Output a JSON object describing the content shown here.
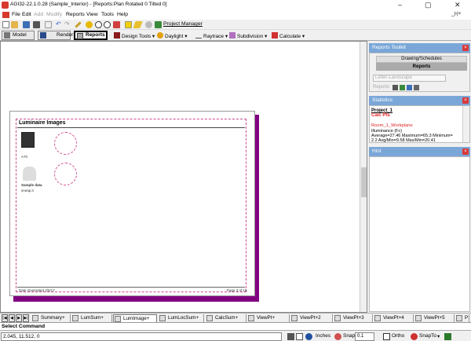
{
  "window": {
    "title": "AGI32-22.1.0.28 (Sample_Interior) - [Reports:Plan Rotated 0 Tilted 0]",
    "min": "–",
    "max": "▢",
    "restore": "_|▫|×"
  },
  "menu": {
    "file": "File",
    "edit": "Edit",
    "add": "Add",
    "modify": "Modify",
    "reports": "Reports",
    "view": "View",
    "tools": "Tools",
    "help": "Help"
  },
  "toolbar1": {
    "project_manager": "Project Manager"
  },
  "modes": {
    "model": "Model",
    "render": "Render",
    "reports": "Reports",
    "design_tools": "Design Tools",
    "daylight": "Daylight",
    "raytrace": "Raytrace",
    "subdivision": "Subdivision",
    "calculate": "Calculate"
  },
  "page": {
    "section_title": "Luminaire Images",
    "lum1": {
      "img_label": "Sample data",
      "code": "A70"
    },
    "lum2": {
      "img_label": "Sample data",
      "code": "sneap.it"
    },
    "footer_left": "Date Generated 2/5/17",
    "footer_right": "Page 3 of 15"
  },
  "reports_toolkit": {
    "title": "Reports Toolkit",
    "tab1": "Drawing/Schedules",
    "tab2": "Reports",
    "combo_value": "Letter-Landscape",
    "reports_label": "Reports"
  },
  "statistics": {
    "title": "Statistics",
    "project": "Project_1",
    "calc_pts": "Calc Pts",
    "room": "Room_1_Workplane",
    "illum": "Illuminance (Fc)",
    "avg": "Average=27.46  Maximum=65.3  Minimum=",
    "line4": "2.2   Avg/Min=9.58   Max/Min=20.41"
  },
  "hint": {
    "title": "Hint"
  },
  "sheet_tabs": [
    {
      "label": "Summary+",
      "selected": false
    },
    {
      "label": "LumSum+",
      "selected": false
    },
    {
      "label": "LumImage+",
      "selected": true
    },
    {
      "label": "LumLocSum+",
      "selected": false
    },
    {
      "label": "CalcSum+",
      "selected": false
    },
    {
      "label": "ViewPt+",
      "selected": false
    },
    {
      "label": "ViewPt+2",
      "selected": false
    },
    {
      "label": "ViewPt+3",
      "selected": false
    },
    {
      "label": "ViewPt+4",
      "selected": false
    },
    {
      "label": "ViewPt+5",
      "selected": false
    },
    {
      "label": "P",
      "selected": false
    }
  ],
  "command": {
    "label": "Select Command"
  },
  "status": {
    "coords": "2.045, 11.512, 0",
    "units": "Inches",
    "snap": "Snap",
    "snap_value": "0.1",
    "ortho": "Ortho",
    "snapto": "SnapTo"
  },
  "colors": {
    "accent": "#7aa7d8",
    "page_shadow": "#800080",
    "calc_red": "#e02020"
  }
}
